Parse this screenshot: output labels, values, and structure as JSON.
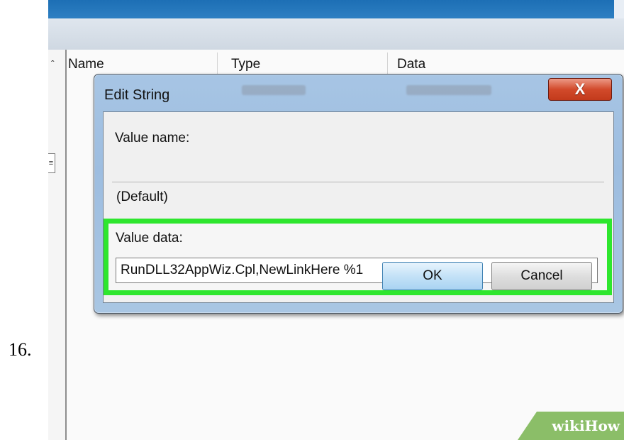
{
  "step": {
    "number": "16."
  },
  "columns": [
    {
      "label": "Name"
    },
    {
      "label": "Type"
    },
    {
      "label": "Data"
    }
  ],
  "dialog": {
    "title": "Edit String",
    "close_glyph": "X",
    "value_name_label": "Value name:",
    "value_name": "(Default)",
    "value_data_label": "Value data:",
    "value_data": "RunDLL32AppWiz.Cpl,NewLinkHere %1",
    "ok_label": "OK",
    "cancel_label": "Cancel",
    "highlight_color": "#2ee62e"
  },
  "watermark": {
    "part1": "wiki",
    "part2": "How"
  },
  "icons": {
    "tree_arrow": "up-arrow-icon",
    "tree_mark": "collapse-icon",
    "close": "close-icon"
  }
}
